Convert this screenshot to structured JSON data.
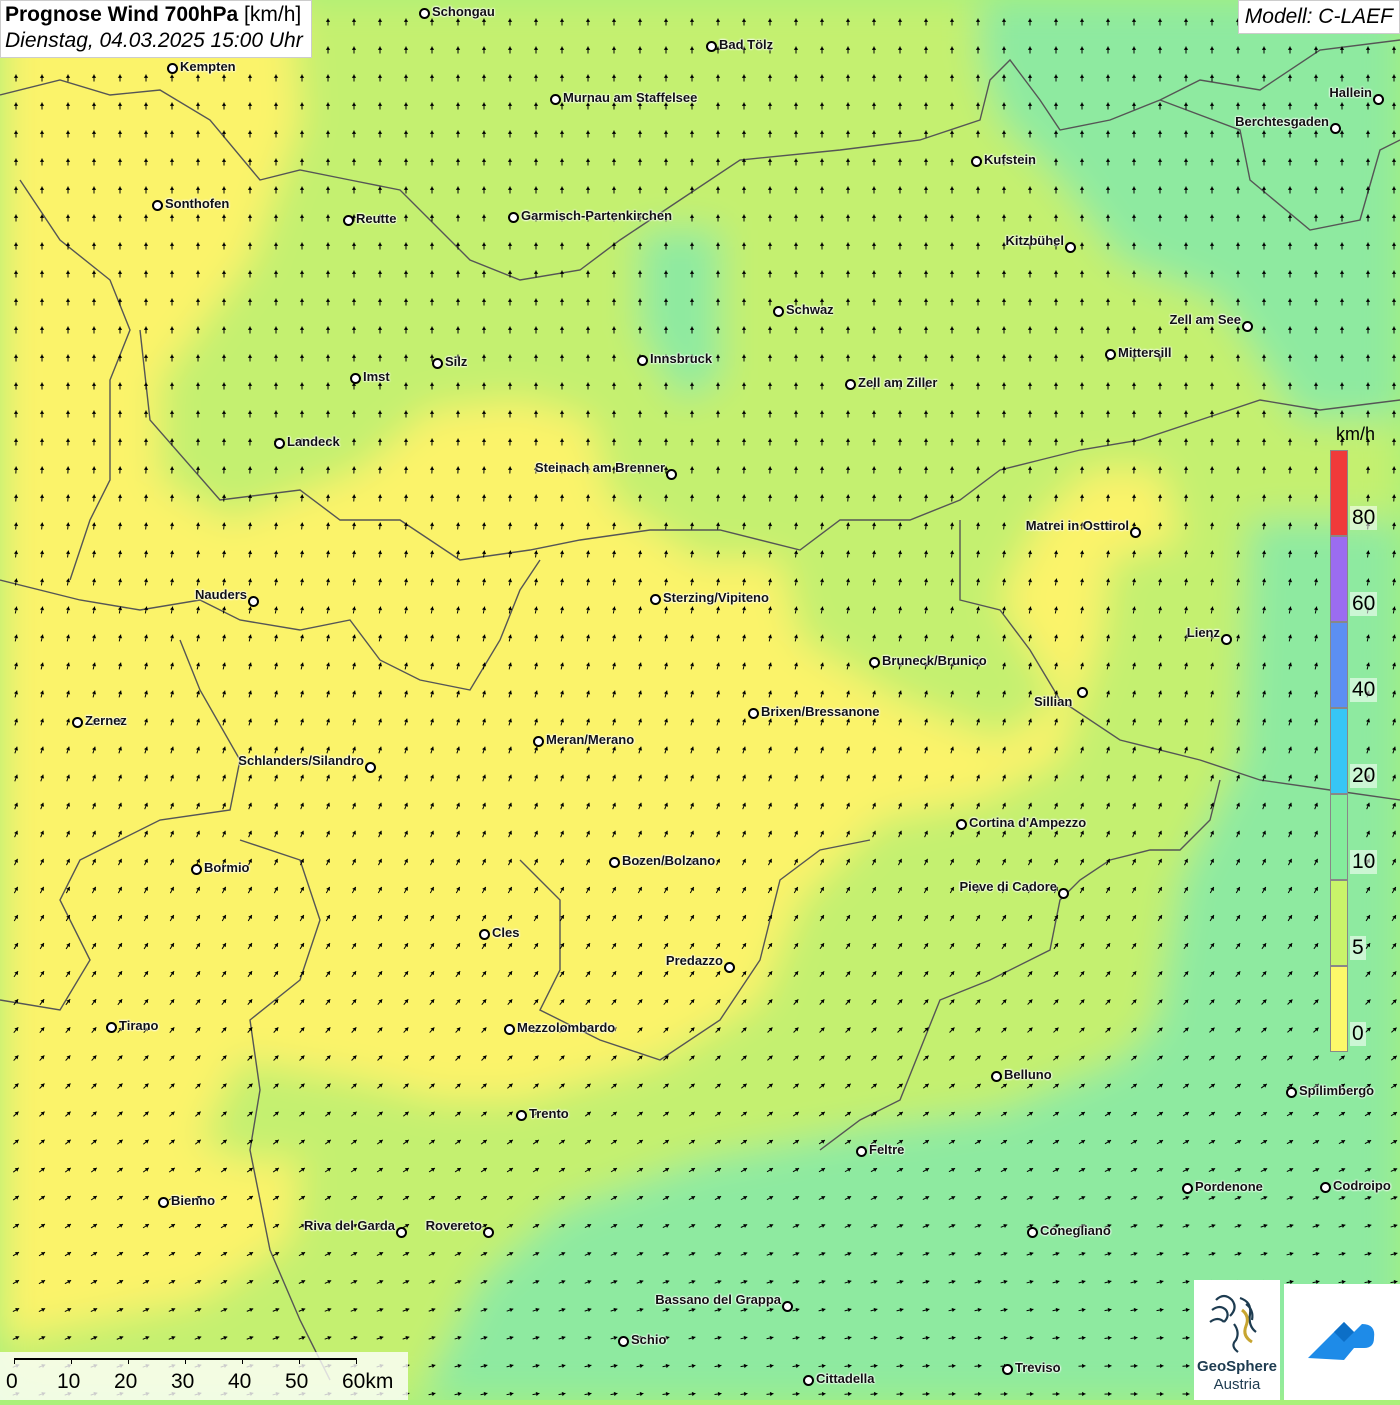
{
  "header": {
    "title_bold": "Prognose Wind 700hPa",
    "title_unit": "[km/h]",
    "datetime": "Dienstag, 04.03.2025 15:00 Uhr",
    "model": "Modell: C-LAEF"
  },
  "legend": {
    "unit": "km/h",
    "levels": [
      {
        "label": "80",
        "color": "#f03a3a"
      },
      {
        "label": "60",
        "color": "#9b6cf0"
      },
      {
        "label": "40",
        "color": "#5c8ff2"
      },
      {
        "label": "20",
        "color": "#37c6f5"
      },
      {
        "label": "10",
        "color": "#84ec9c"
      },
      {
        "label": "5",
        "color": "#c9f46a"
      },
      {
        "label": "0",
        "color": "#fdf86a"
      }
    ]
  },
  "scale": {
    "labels": [
      "0",
      "10",
      "20",
      "30",
      "40",
      "50",
      "60km"
    ]
  },
  "logo": {
    "name_line1": "GeoSphere",
    "name_line2": "Austria"
  },
  "colors": {
    "calm": "#fbf36a",
    "light": "#c4f070",
    "moderate": "#8eeaa0",
    "arrow": "#000000",
    "border": "#555555"
  },
  "cities": [
    {
      "name": "Schongau"
    },
    {
      "name": "Bad Tölz"
    },
    {
      "name": "Kempten"
    },
    {
      "name": "Murnau am Staffelsee"
    },
    {
      "name": "Hallein"
    },
    {
      "name": "Berchtesgaden"
    },
    {
      "name": "Kufstein"
    },
    {
      "name": "Sonthofen"
    },
    {
      "name": "Reutte"
    },
    {
      "name": "Garmisch-Partenkirchen"
    },
    {
      "name": "Kitzbühel"
    },
    {
      "name": "Schwaz"
    },
    {
      "name": "Zell am See"
    },
    {
      "name": "Mittersill"
    },
    {
      "name": "Innsbruck"
    },
    {
      "name": "Silz"
    },
    {
      "name": "Imst"
    },
    {
      "name": "Zell am Ziller"
    },
    {
      "name": "Landeck"
    },
    {
      "name": "Steinach am Brenner"
    },
    {
      "name": "Matrei in Osttirol"
    },
    {
      "name": "Nauders"
    },
    {
      "name": "Sterzing/Vipiteno"
    },
    {
      "name": "Lienz"
    },
    {
      "name": "Bruneck/Brunico"
    },
    {
      "name": "Sillian"
    },
    {
      "name": "Brixen/Bressanone"
    },
    {
      "name": "Zernez"
    },
    {
      "name": "Meran/Merano"
    },
    {
      "name": "Schlanders/Silandro"
    },
    {
      "name": "Cortina d'Ampezzo"
    },
    {
      "name": "Bozen/Bolzano"
    },
    {
      "name": "Bormio"
    },
    {
      "name": "Pieve di Cadore"
    },
    {
      "name": "Cles"
    },
    {
      "name": "Predazzo"
    },
    {
      "name": "Tirano"
    },
    {
      "name": "Mezzolombardo"
    },
    {
      "name": "Belluno"
    },
    {
      "name": "Spilimbergo"
    },
    {
      "name": "Trento"
    },
    {
      "name": "Feltre"
    },
    {
      "name": "Pordenone"
    },
    {
      "name": "Codroipo"
    },
    {
      "name": "Bienno"
    },
    {
      "name": "Riva del Garda"
    },
    {
      "name": "Rovereto"
    },
    {
      "name": "Conegliano"
    },
    {
      "name": "Bassano del Grappa"
    },
    {
      "name": "Schio"
    },
    {
      "name": "Treviso"
    },
    {
      "name": "Cittadella"
    }
  ]
}
